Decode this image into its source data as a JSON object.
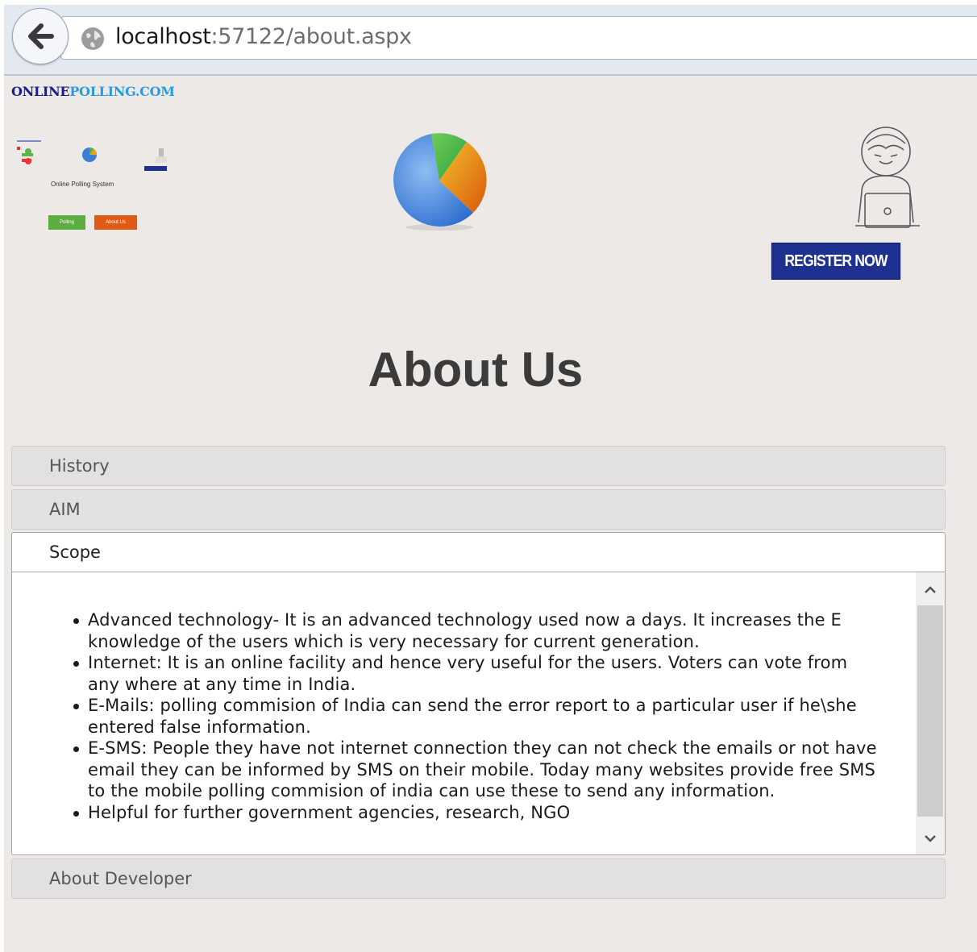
{
  "browser": {
    "url_host": "localhost",
    "url_rest": ":57122/about.aspx"
  },
  "site": {
    "logo_part1": "ONLINE",
    "logo_part2": "POLLING.COM",
    "thumbnail": {
      "caption": "Online Polling System",
      "button_polling": "Polling",
      "button_about": "About Us"
    },
    "register_button": "REGISTER NOW"
  },
  "page": {
    "title": "About Us"
  },
  "accordion": {
    "history": "History",
    "aim": "AIM",
    "scope": "Scope",
    "about_developer": "About Developer",
    "scope_items": [
      "Advanced technology- It is an advanced technology used now a days. It increases the E knowledge of the users which is very necessary for current generation.",
      "Internet: It is an online facility and hence very useful for the users. Voters can vote from any where at any time in India.",
      "E-Mails: polling commision of India can send the error report to a particular user if he\\she entered false information.",
      "E-SMS: People they have not internet connection they can not check the emails or not have email they can be informed by SMS on their mobile. Today many websites provide free SMS to the mobile polling commision of india can use these to send any information.",
      "Helpful for further government agencies, research, NGO"
    ]
  },
  "colors": {
    "page_background": "#ece9e6",
    "register_button": "#1e3191",
    "logo_dark": "#1d1d8a",
    "logo_light": "#2a9be0"
  }
}
